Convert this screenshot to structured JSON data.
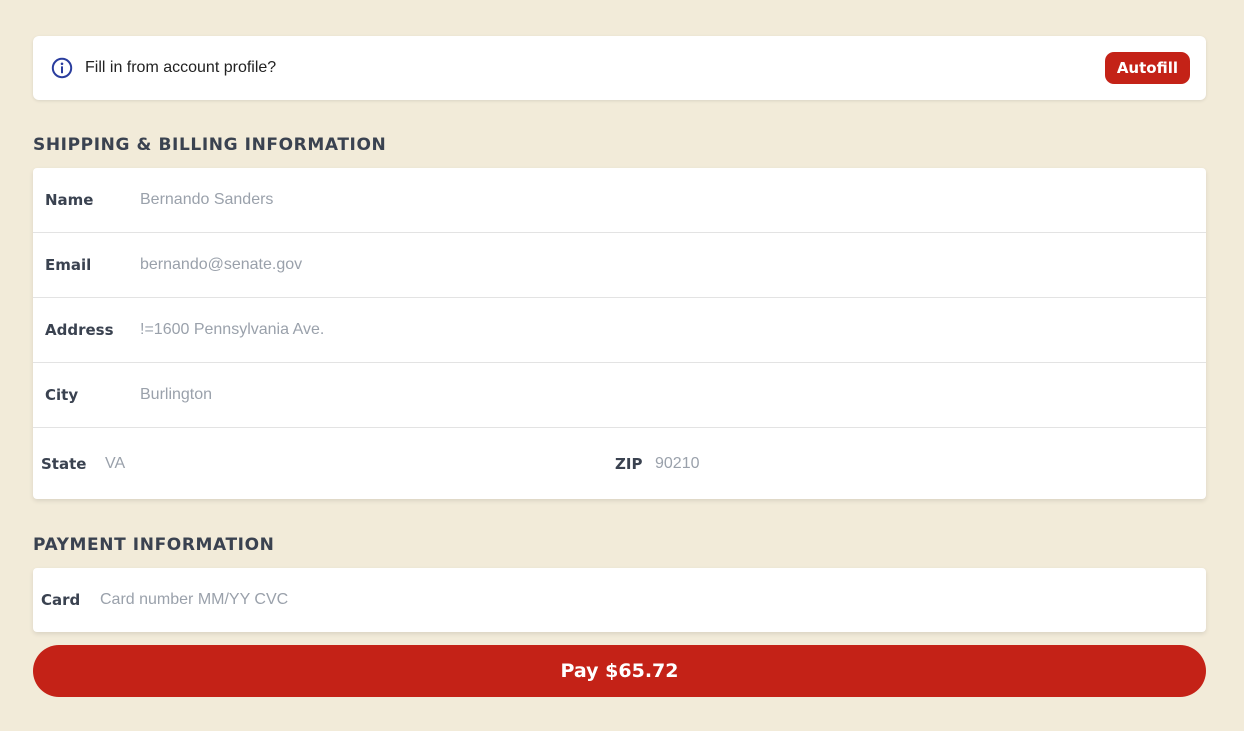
{
  "banner": {
    "icon": "info-icon",
    "text": "Fill in from account profile?",
    "autofill_label": "Autofill"
  },
  "shipping": {
    "heading": "SHIPPING & BILLING INFORMATION",
    "name": {
      "label": "Name",
      "value": "Bernando Sanders"
    },
    "email": {
      "label": "Email",
      "value": "bernando@senate.gov"
    },
    "address": {
      "label": "Address",
      "value": "!=1600 Pennsylvania Ave."
    },
    "city": {
      "label": "City",
      "value": "Burlington"
    },
    "state": {
      "label": "State",
      "value": "VA"
    },
    "zip": {
      "label": "ZIP",
      "value": "90210"
    }
  },
  "payment": {
    "heading": "PAYMENT INFORMATION",
    "card": {
      "label": "Card",
      "placeholder": "Card number MM/YY CVC"
    }
  },
  "pay_button": {
    "label": "Pay $65.72"
  },
  "colors": {
    "background": "#f2ebd9",
    "accent": "#c42217",
    "label_text": "#3a4250",
    "value_text": "#9aa1ab",
    "info_icon": "#2a3d9e"
  }
}
